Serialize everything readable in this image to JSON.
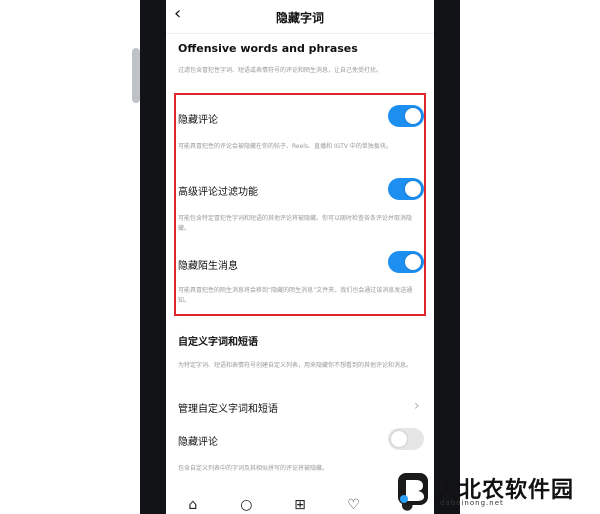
{
  "nav": {
    "title": "隐藏字词"
  },
  "offensive": {
    "title": "Offensive words and phrases",
    "desc": "过滤包含冒犯性字词、短语或表情符号的评论和陌生消息，让自己免受打扰。"
  },
  "toggles": [
    {
      "label": "隐藏评论",
      "state": "on",
      "desc": "可能具冒犯性的评论会被隐藏在你的帖子、Reels、直播和 IGTV 中的单独板块。"
    },
    {
      "label": "高级评论过滤功能",
      "state": "on",
      "desc": "可能包含特定冒犯性字词和短语的其他评论将被隐藏。你可以随时检查各条评论并取消隐藏。"
    },
    {
      "label": "隐藏陌生消息",
      "state": "on",
      "desc": "可能具冒犯性的陌生消息将会移到“隐藏的陌生消息”文件夹。我们也会通过该消息发送通知。"
    }
  ],
  "custom": {
    "title": "自定义字词和短语",
    "desc": "为特定字词、短语和表情符号创建自定义列表，用来隐藏你不想看到的其他评论和消息。",
    "manage_label": "管理自定义字词和短语",
    "hide_label": "隐藏评论",
    "hide_state": "off",
    "hide_desc": "包含自定义列表中的字词及其相似拼写的评论将被隐藏。"
  },
  "colors": {
    "toggle_on": "#1d8ff0",
    "highlight": "#e1252d"
  },
  "watermark": {
    "text": "大北农软件园",
    "sub": "dabeinong.net"
  }
}
